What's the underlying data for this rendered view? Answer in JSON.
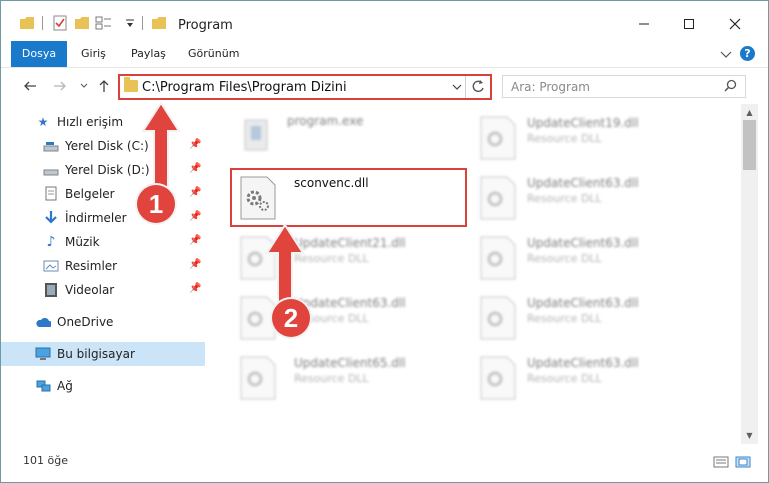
{
  "window": {
    "title": "Program",
    "controls": [
      "minimize-icon",
      "maximize-icon",
      "close-icon"
    ]
  },
  "ribbon": {
    "tabs": [
      "Dosya",
      "Giriş",
      "Paylaş",
      "Görünüm"
    ]
  },
  "address_bar": {
    "path": "C:\\Program Files\\Program Dizini"
  },
  "search": {
    "placeholder": "Ara: Program"
  },
  "sidebar": {
    "items": [
      {
        "label": "Hızlı erişim",
        "icon": "star-icon",
        "pinned": false
      },
      {
        "label": "Yerel Disk (C:)",
        "icon": "drive-icon",
        "pinned": true
      },
      {
        "label": "Yerel Disk (D:)",
        "icon": "drive-icon",
        "pinned": true
      },
      {
        "label": "Belgeler",
        "icon": "documents-icon",
        "pinned": true
      },
      {
        "label": "İndirmeler",
        "icon": "download-icon",
        "pinned": true
      },
      {
        "label": "Müzik",
        "icon": "music-icon",
        "pinned": true
      },
      {
        "label": "Resimler",
        "icon": "pictures-icon",
        "pinned": true
      },
      {
        "label": "Videolar",
        "icon": "video-icon",
        "pinned": true
      },
      {
        "label": "OneDrive",
        "icon": "cloud-icon",
        "pinned": false
      },
      {
        "label": "Bu bilgisayar",
        "icon": "computer-icon",
        "pinned": false,
        "selected": true
      },
      {
        "label": "Ağ",
        "icon": "network-icon",
        "pinned": false
      }
    ]
  },
  "files": [
    {
      "name": "program.exe",
      "type": ""
    },
    {
      "name": "sconvenc.dll",
      "type": "",
      "highlighted": true
    },
    {
      "name": "UpdateClient21.dll",
      "type": "Resource DLL"
    },
    {
      "name": "UpdateClient63.dll",
      "type": "Resource DLL"
    },
    {
      "name": "UpdateClient65.dll",
      "type": "Resource DLL"
    },
    {
      "name": "UpdateClient19.dll",
      "type": "Resource DLL"
    },
    {
      "name": "UpdateClient63.dll",
      "type": "Resource DLL"
    },
    {
      "name": "UpdateClient63.dll",
      "type": "Resource DLL"
    },
    {
      "name": "UpdateClient63.dll",
      "type": "Resource DLL"
    },
    {
      "name": "UpdateClient63.dll",
      "type": "Resource DLL"
    }
  ],
  "status": {
    "count": "101 öğe"
  },
  "annotations": {
    "step1": "1",
    "step2": "2"
  },
  "colors": {
    "accent": "#1979ca",
    "highlight": "#d9423a",
    "selection": "#cce4f7"
  }
}
